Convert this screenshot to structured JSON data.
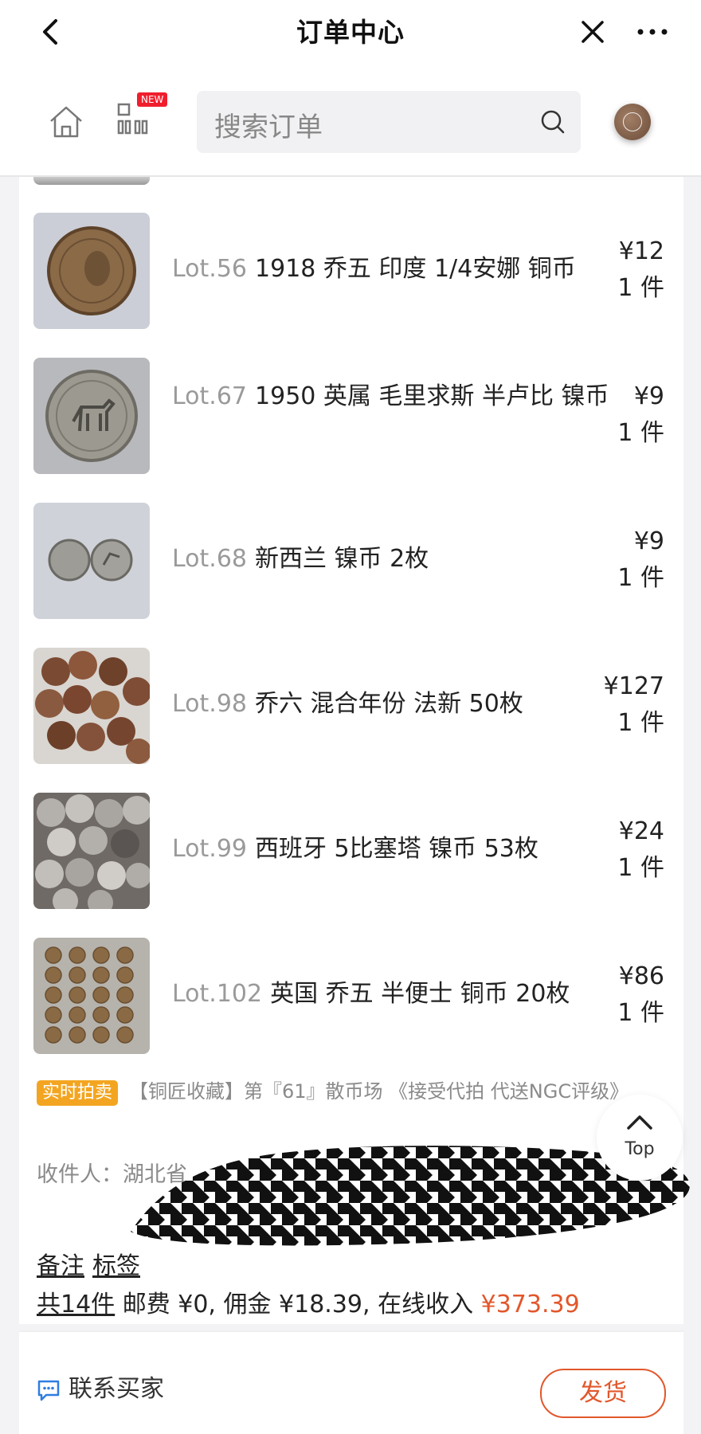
{
  "titlebar": {
    "title": "订单中心"
  },
  "navbar": {
    "new_badge": "NEW",
    "search_placeholder": "搜索订单"
  },
  "lots": [
    {
      "lot": "Lot.56",
      "name": "1918 乔五 印度 1/4安娜 铜币",
      "price": "¥12",
      "qty": "1 件"
    },
    {
      "lot": "Lot.67",
      "name": "1950 英属 毛里求斯 半卢比 镍币",
      "price": "¥9",
      "qty": "1 件"
    },
    {
      "lot": "Lot.68",
      "name": "新西兰 镍币 2枚",
      "price": "¥9",
      "qty": "1 件"
    },
    {
      "lot": "Lot.98",
      "name": "乔六 混合年份 法新 50枚",
      "price": "¥127",
      "qty": "1 件"
    },
    {
      "lot": "Lot.99",
      "name": "西班牙 5比塞塔 镍币 53枚",
      "price": "¥24",
      "qty": "1 件"
    },
    {
      "lot": "Lot.102",
      "name": "英国 乔五 半便士 铜币 20枚",
      "price": "¥86",
      "qty": "1 件"
    }
  ],
  "auction": {
    "tag": "实时拍卖",
    "text": "【铜匠收藏】第『61』散币场 《接受代拍 代送NGC评级》"
  },
  "receiver": {
    "label": "收件人：",
    "value": "湖北省"
  },
  "links": {
    "note": "备注",
    "tag": "标签"
  },
  "summary": {
    "count": "共14件",
    "fees": " 邮费 ¥0, 佣金 ¥18.39, 在线收入 ",
    "income": "¥373.39"
  },
  "top_button": {
    "label": "Top"
  },
  "bottombar": {
    "contact": "联系买家",
    "ship": "发货"
  },
  "colors": {
    "accent": "#e2572b",
    "tag": "#f3a521",
    "badge": "#f01e2d"
  }
}
